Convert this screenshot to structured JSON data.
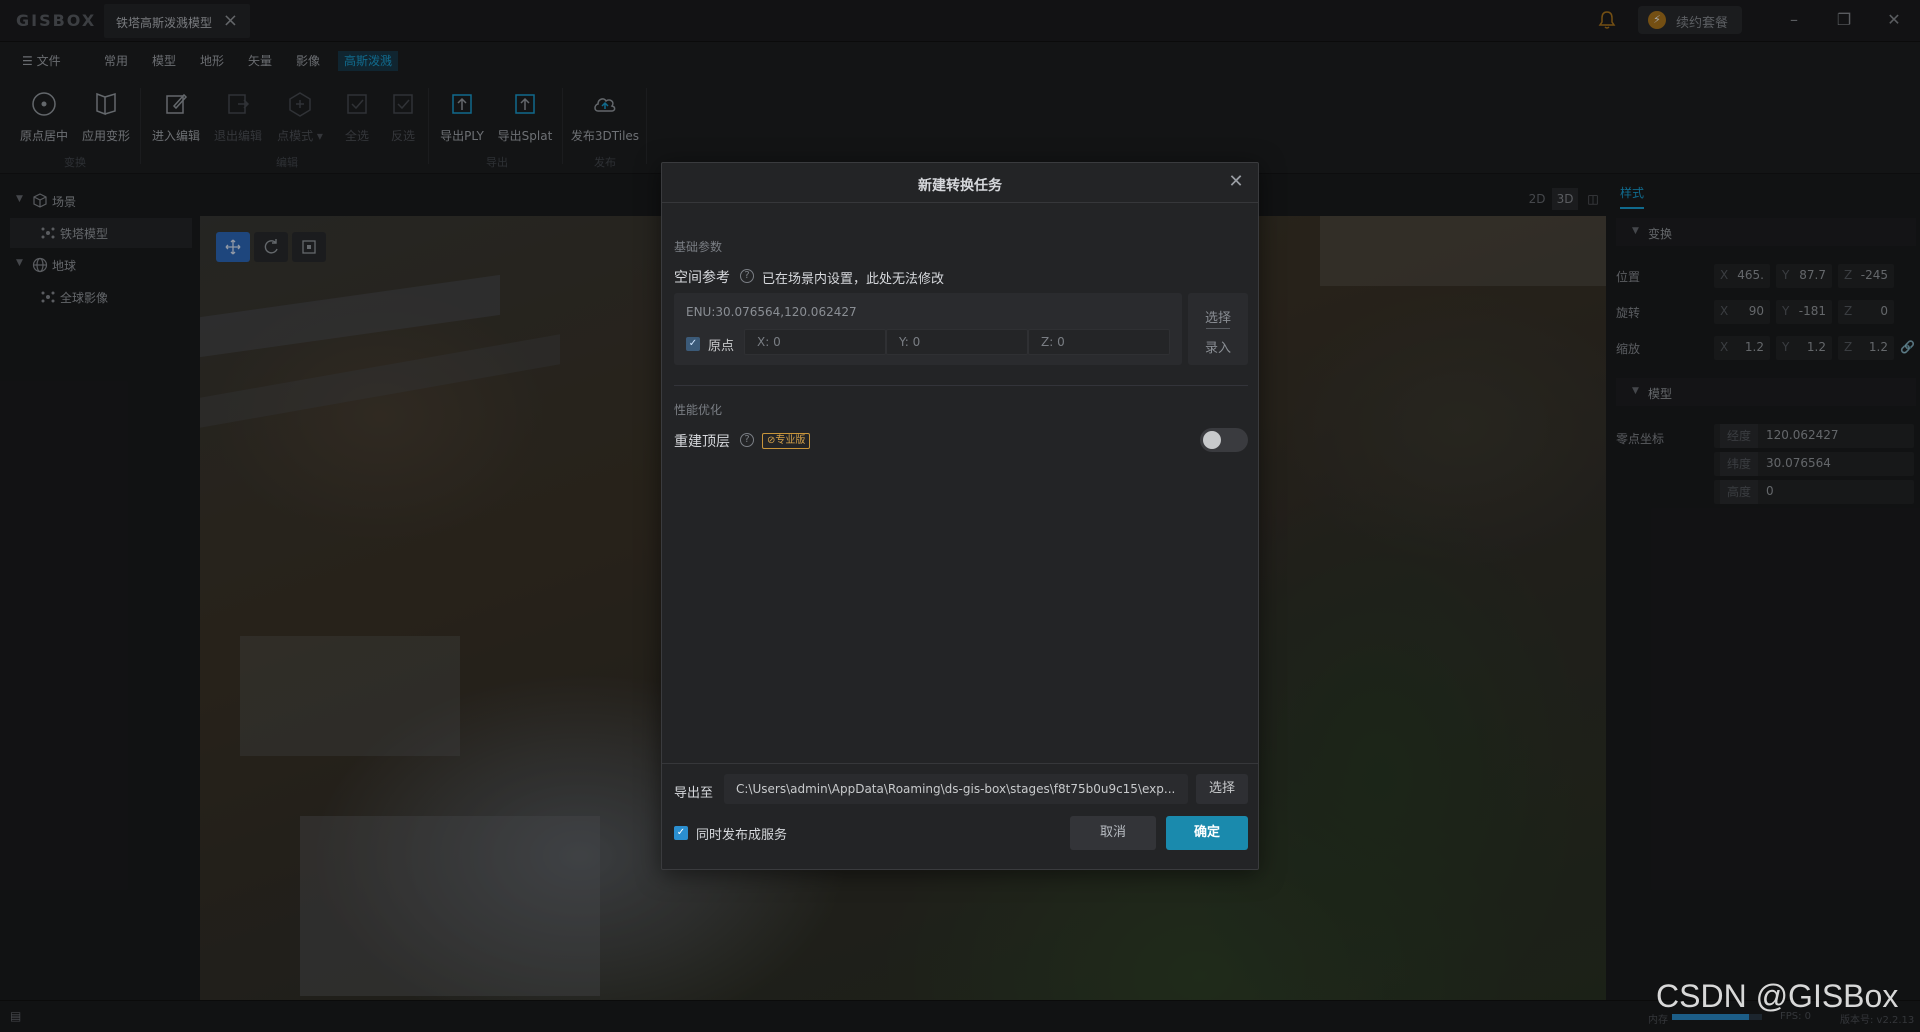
{
  "app": {
    "logo": "GISBOX"
  },
  "tab": {
    "title": "铁塔高斯泼溅模型"
  },
  "titlebar": {
    "plan_label": "续约套餐"
  },
  "menu": {
    "file": "文件",
    "items": [
      "常用",
      "模型",
      "地形",
      "矢量",
      "影像",
      "高斯泼溅"
    ],
    "active_index": 5
  },
  "toolbar": {
    "tools": [
      {
        "label": "原点居中",
        "icon": "target-icon",
        "enabled": true
      },
      {
        "label": "应用变形",
        "icon": "transform-icon",
        "enabled": true
      },
      {
        "label": "进入编辑",
        "icon": "edit-icon",
        "enabled": true
      },
      {
        "label": "退出编辑",
        "icon": "exit-edit-icon",
        "enabled": false
      },
      {
        "label": "点模式",
        "icon": "point-mode-icon",
        "enabled": false
      },
      {
        "label": "全选",
        "icon": "select-all-icon",
        "enabled": false
      },
      {
        "label": "反选",
        "icon": "invert-select-icon",
        "enabled": false
      },
      {
        "label": "导出PLY",
        "icon": "export-ply-icon",
        "enabled": true
      },
      {
        "label": "导出Splat",
        "icon": "export-splat-icon",
        "enabled": true
      },
      {
        "label": "发布3DTiles",
        "icon": "publish-cloud-icon",
        "enabled": true
      }
    ],
    "groups": [
      "变换",
      "编辑",
      "导出",
      "发布"
    ]
  },
  "scene_tree": {
    "items": [
      {
        "label": "场景",
        "level": 0
      },
      {
        "label": "铁塔模型",
        "level": 1,
        "selected": true
      },
      {
        "label": "地球",
        "level": 0
      },
      {
        "label": "全球影像",
        "level": 1
      }
    ]
  },
  "view_modes": [
    "2D",
    "3D"
  ],
  "properties": {
    "tab": "样式",
    "transform_section": "变换",
    "position_label": "位置",
    "rotation_label": "旋转",
    "scale_label": "缩放",
    "position": {
      "x": "465.",
      "y": "87.7",
      "z": "-245"
    },
    "rotation": {
      "x": "90",
      "y": "-181",
      "z": "0"
    },
    "scale": {
      "x": "1.2",
      "y": "1.2",
      "z": "1.2"
    },
    "axis_x": "X",
    "axis_y": "Y",
    "axis_z": "Z",
    "model_section": "模型",
    "origin_label": "零点坐标",
    "longitude_key": "经度",
    "latitude_key": "纬度",
    "height_key": "高度",
    "longitude": "120.062427",
    "latitude": "30.076564",
    "height": "0"
  },
  "dialog": {
    "title": "新建转换任务",
    "basic_section": "基础参数",
    "spatial_ref_label": "空间参考",
    "spatial_ref_note": "已在场景内设置，此处无法修改",
    "enu": "ENU:30.076564,120.062427",
    "origin_label": "原点",
    "x_label": "X:",
    "y_label": "Y:",
    "z_label": "Z:",
    "origin": {
      "x": "0",
      "y": "0",
      "z": "0"
    },
    "choose_label": "选择",
    "input_label": "录入",
    "perf_section": "性能优化",
    "rebuild_label": "重建顶层",
    "pro_badge": "专业版",
    "rebuild_enabled": false,
    "export_label": "导出至",
    "export_path": "C:\\Users\\admin\\AppData\\Roaming\\ds-gis-box\\stages\\f8t75b0u9c15\\exp...",
    "export_choose": "选择",
    "publish_label": "同时发布成服务",
    "publish_checked": true,
    "cancel": "取消",
    "ok": "确定"
  },
  "statusbar": {
    "memory_label": "内存",
    "fps": "FPS: 0",
    "version": "版本号: v2.2.13"
  },
  "watermark": "CSDN @GISBox",
  "colors": {
    "accent": "#1aa3d9",
    "primary_button": "#1a8aad",
    "pro_badge": "#d8a44a"
  }
}
